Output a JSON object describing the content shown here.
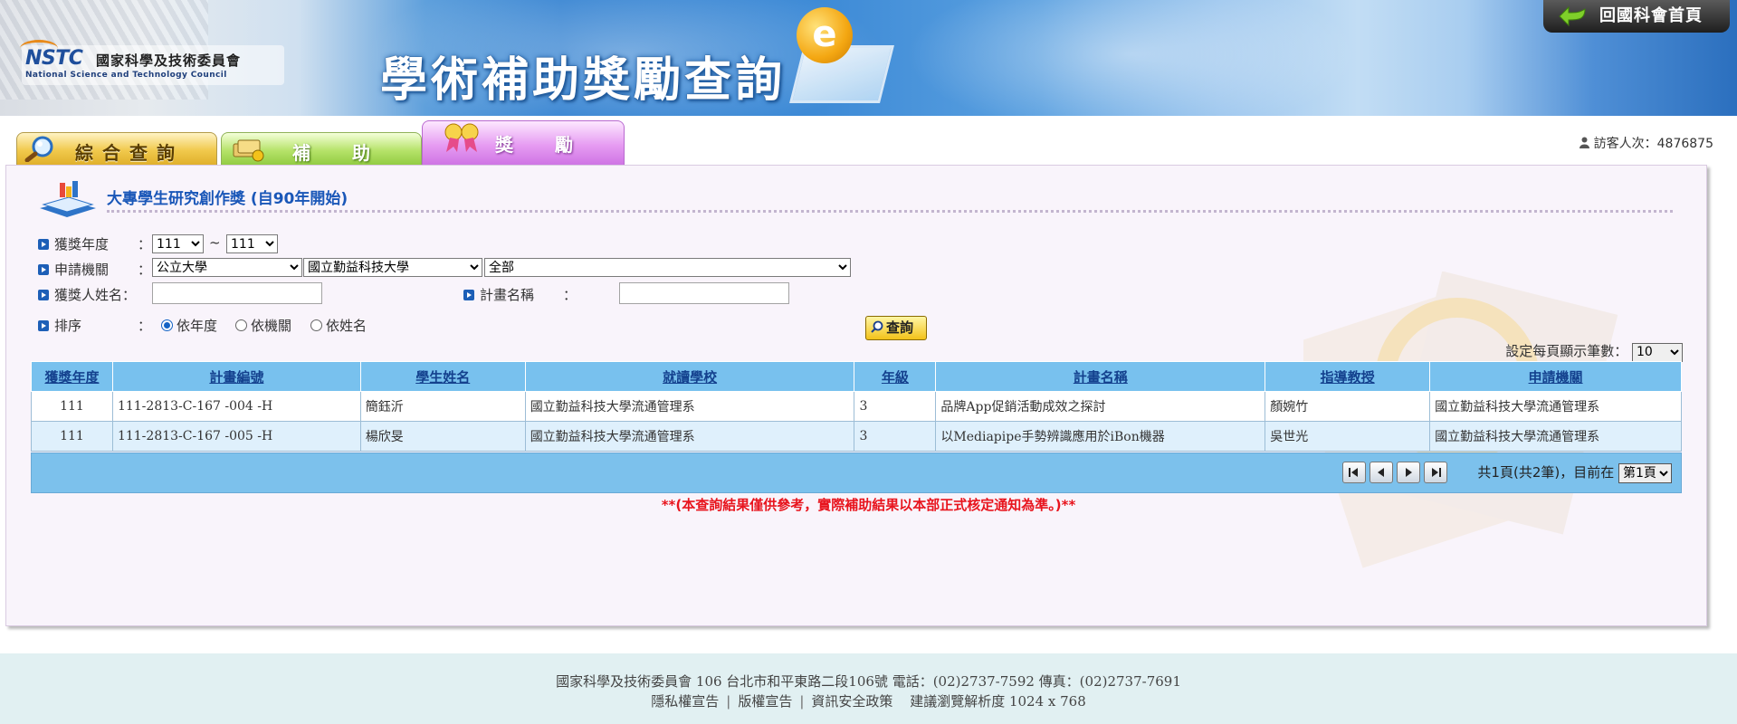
{
  "header": {
    "logo_mark": "NSTC",
    "logo_cn": "國家科學及技術委員會",
    "logo_en": "National Science and Technology Council",
    "site_title": "學術補助獎勵查詢",
    "home_label": "回國科會首頁"
  },
  "tabs": [
    {
      "label": "綜合查詢"
    },
    {
      "label": "補助"
    },
    {
      "label": "獎勵"
    }
  ],
  "visitors": {
    "label": "訪客人次：4876875"
  },
  "section": {
    "title": "大專學生研究創作獎 (自90年開始)"
  },
  "form": {
    "year": {
      "label": "獲獎年度",
      "colon": "：",
      "from": "111",
      "to": "111",
      "tilde": "~"
    },
    "institution": {
      "label": "申請機關",
      "colon": "：",
      "type": "公立大學",
      "school": "國立勤益科技大學",
      "dept": "全部"
    },
    "name": {
      "label": "獲獎人姓名：",
      "value": ""
    },
    "project": {
      "label": "計畫名稱",
      "colon": "：",
      "value": ""
    },
    "sort": {
      "label": "排序",
      "colon": "：",
      "options": [
        "依年度",
        "依機關",
        "依姓名"
      ],
      "selected": 0
    },
    "query_label": "查詢"
  },
  "per_page": {
    "label": "設定每頁顯示筆數：",
    "value": "10"
  },
  "table": {
    "headers": [
      "獲獎年度",
      "計畫編號",
      "學生姓名",
      "就讀學校",
      "年級",
      "計畫名稱",
      "指導教授",
      "申請機關"
    ],
    "rows": [
      [
        "111",
        "111-2813-C-167 -004 -H",
        "簡鈺沂",
        "國立勤益科技大學流通管理系",
        "3",
        "品牌App促銷活動成效之探討",
        "顏婉竹",
        "國立勤益科技大學流通管理系"
      ],
      [
        "111",
        "111-2813-C-167 -005 -H",
        "楊欣旻",
        "國立勤益科技大學流通管理系",
        "3",
        "以Mediapipe手勢辨識應用於iBon機器",
        "吳世光",
        "國立勤益科技大學流通管理系"
      ]
    ]
  },
  "pager": {
    "summary": "共1頁(共2筆)，目前在",
    "page": "第1頁"
  },
  "notice": "**(本查詢結果僅供參考，實際補助結果以本部正式核定通知為準。)**",
  "footer": {
    "address": "國家科學及技術委員會  106  台北市和平東路二段106號  電話：(02)2737-7592  傳真：(02)2737-7691",
    "links": [
      "隱私權宣告",
      "版權宣告",
      "資訊安全政策"
    ],
    "resolution": "建議瀏覽解析度 1024 x 768"
  },
  "colors": {
    "tab_search": "#f1c94c",
    "tab_grant": "#b6e36a",
    "tab_award": "#e69cf2",
    "table_header": "#78c1ee",
    "notice": "#e8141d",
    "title": "#1a57b8"
  }
}
